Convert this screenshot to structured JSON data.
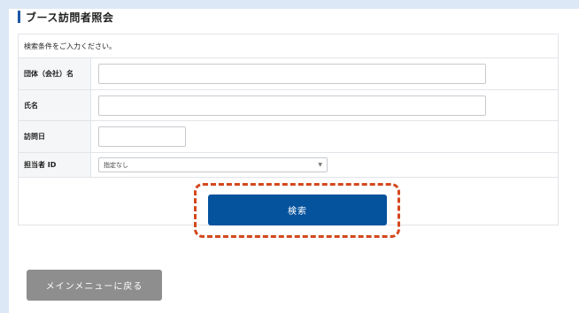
{
  "page": {
    "title": "ブース訪問者照会"
  },
  "form": {
    "note": "検索条件をご入力ください。",
    "fields": [
      {
        "label": "団体（会社）名",
        "value": "",
        "placeholder": ""
      },
      {
        "label": "氏名",
        "value": "",
        "placeholder": ""
      },
      {
        "label": "訪問日",
        "value": "",
        "placeholder": ""
      },
      {
        "label": "担当者 ID",
        "selected": "指定なし"
      }
    ],
    "search_label": "検索"
  },
  "footer": {
    "menu_label": "メインメニューに戻る"
  },
  "icons": {
    "select_caret": "chevron-down-icon"
  },
  "colors": {
    "accent": "#05529d",
    "highlight": "#d3481e",
    "secondary_button": "#8e8e8e"
  }
}
